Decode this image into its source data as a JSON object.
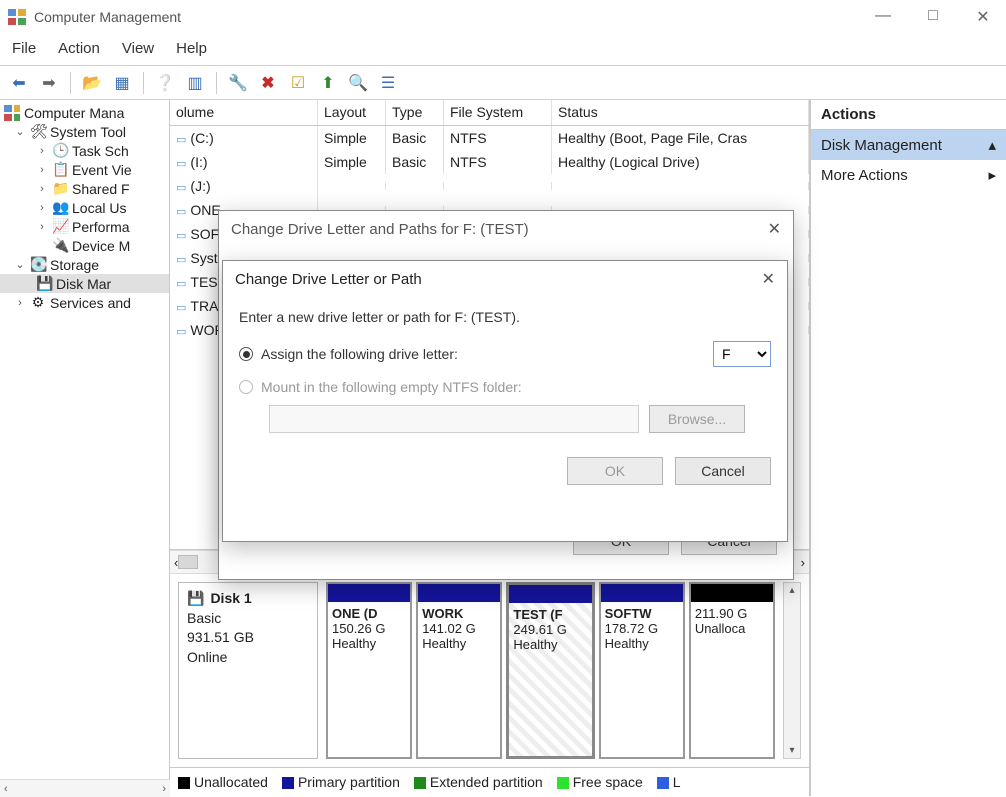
{
  "window": {
    "title": "Computer Management"
  },
  "menu": {
    "file": "File",
    "action": "Action",
    "view": "View",
    "help": "Help"
  },
  "tree": {
    "root": "Computer Mana",
    "systools": "System Tool",
    "items_sys": [
      "Task Sch",
      "Event Vie",
      "Shared F",
      "Local Us",
      "Performa",
      "Device M"
    ],
    "storage": "Storage",
    "diskmgmt": "Disk Mar",
    "services": "Services and"
  },
  "vol_headers": {
    "volume": "olume",
    "layout": "Layout",
    "type": "Type",
    "fs": "File System",
    "status": "Status"
  },
  "volumes": [
    {
      "name": "(C:)",
      "layout": "Simple",
      "type": "Basic",
      "fs": "NTFS",
      "status": "Healthy (Boot, Page File, Cras"
    },
    {
      "name": "(I:)",
      "layout": "Simple",
      "type": "Basic",
      "fs": "NTFS",
      "status": "Healthy (Logical Drive)"
    },
    {
      "name": "(J:)",
      "layout": "",
      "type": "",
      "fs": "",
      "status": ""
    },
    {
      "name": "ONE",
      "layout": "",
      "type": "",
      "fs": "",
      "status": ""
    },
    {
      "name": "SOFT",
      "layout": "",
      "type": "",
      "fs": "",
      "status": ""
    },
    {
      "name": "Syste",
      "layout": "",
      "type": "",
      "fs": "",
      "status": ""
    },
    {
      "name": "TEST",
      "layout": "",
      "type": "",
      "fs": "",
      "status": ""
    },
    {
      "name": "TRAC",
      "layout": "",
      "type": "",
      "fs": "",
      "status": ""
    },
    {
      "name": "WOR",
      "layout": "",
      "type": "",
      "fs": "",
      "status": ""
    }
  ],
  "disk": {
    "label": "Disk 1",
    "type": "Basic",
    "size": "931.51 GB",
    "state": "Online",
    "parts": [
      {
        "name": "ONE (D",
        "size": "150.26 G",
        "stat": "Healthy",
        "sel": false,
        "unalloc": false
      },
      {
        "name": "WORK",
        "size": "141.02 G",
        "stat": "Healthy",
        "sel": false,
        "unalloc": false
      },
      {
        "name": "TEST (F",
        "size": "249.61 G",
        "stat": "Healthy",
        "sel": true,
        "unalloc": false
      },
      {
        "name": "SOFTW",
        "size": "178.72 G",
        "stat": "Healthy",
        "sel": false,
        "unalloc": false
      },
      {
        "name": "",
        "size": "211.90 G",
        "stat": "Unalloca",
        "sel": false,
        "unalloc": true
      }
    ]
  },
  "legend": {
    "unalloc": "Unallocated",
    "primary": "Primary partition",
    "extended": "Extended partition",
    "free": "Free space",
    "last": "L"
  },
  "actions": {
    "header": "Actions",
    "diskmgmt": "Disk Management",
    "more": "More Actions"
  },
  "dlg_outer": {
    "title": "Change Drive Letter and Paths for F: (TEST)",
    "ok": "OK",
    "cancel": "Cancel"
  },
  "dlg_inner": {
    "title": "Change Drive Letter or Path",
    "prompt": "Enter a new drive letter or path for F: (TEST).",
    "opt_assign": "Assign the following drive letter:",
    "opt_mount": "Mount in the following empty NTFS folder:",
    "drive": "F",
    "browse": "Browse...",
    "ok": "OK",
    "cancel": "Cancel"
  }
}
